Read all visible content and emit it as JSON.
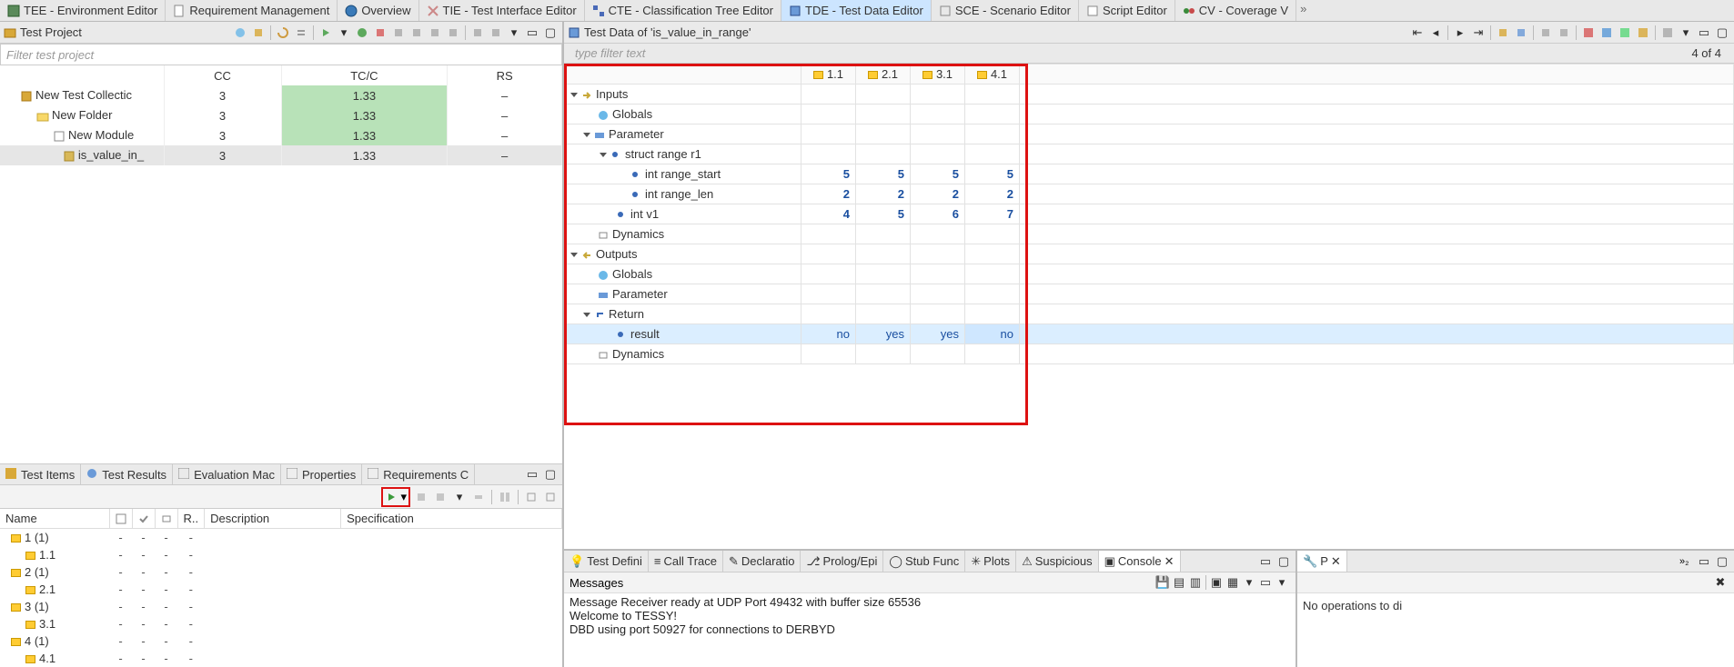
{
  "top_tabs": {
    "tee": "TEE - Environment Editor",
    "req": "Requirement Management",
    "ovw": "Overview",
    "tie": "TIE - Test Interface Editor",
    "cte": "CTE - Classification Tree Editor",
    "tde": "TDE - Test Data Editor",
    "sce": "SCE - Scenario Editor",
    "scr": "Script Editor",
    "cv": "CV - Coverage V"
  },
  "left": {
    "title": "Test Project",
    "filter_ph": "Filter test project",
    "cols": {
      "cc": "CC",
      "tcc": "TC/C",
      "rs": "RS"
    },
    "rows": [
      {
        "name": "New Test Collectic",
        "cc": "3",
        "tcc": "1.33",
        "rs": "–",
        "indent": 1,
        "green": true,
        "icon": "cube"
      },
      {
        "name": "New Folder",
        "cc": "3",
        "tcc": "1.33",
        "rs": "–",
        "indent": 2,
        "green": true,
        "icon": "folder"
      },
      {
        "name": "New Module",
        "cc": "3",
        "tcc": "1.33",
        "rs": "–",
        "indent": 3,
        "green": true,
        "icon": "module"
      },
      {
        "name": "is_value_in_",
        "cc": "3",
        "tcc": "1.33",
        "rs": "–",
        "indent": 4,
        "green": false,
        "icon": "func",
        "sel": true
      }
    ]
  },
  "mid_tabs": {
    "ti": "Test Items",
    "tr": "Test Results",
    "em": "Evaluation Mac",
    "pr": "Properties",
    "rc": "Requirements C"
  },
  "items": {
    "cols": {
      "name": "Name",
      "desc": "Description",
      "spec": "Specification",
      "r": "R.."
    },
    "rows": [
      {
        "name": "1 (1)",
        "lvl": 0
      },
      {
        "name": "1.1",
        "lvl": 1
      },
      {
        "name": "2 (1)",
        "lvl": 0
      },
      {
        "name": "2.1",
        "lvl": 1
      },
      {
        "name": "3 (1)",
        "lvl": 0
      },
      {
        "name": "3.1",
        "lvl": 1
      },
      {
        "name": "4 (1)",
        "lvl": 0
      },
      {
        "name": "4.1",
        "lvl": 1
      }
    ]
  },
  "right": {
    "title": "Test Data of 'is_value_in_range'",
    "filter_ph": "type filter text",
    "counter": "4 of 4",
    "col_heads": [
      "1.1",
      "2.1",
      "3.1",
      "4.1"
    ],
    "tree": {
      "inputs": "Inputs",
      "globals": "Globals",
      "parameter": "Parameter",
      "struct": "struct range r1",
      "range_start": "int range_start",
      "range_len": "int range_len",
      "v1": "int v1",
      "dynamics": "Dynamics",
      "outputs": "Outputs",
      "return": "Return",
      "result": "result"
    },
    "vals": {
      "range_start": [
        "5",
        "5",
        "5",
        "5"
      ],
      "range_len": [
        "2",
        "2",
        "2",
        "2"
      ],
      "v1": [
        "4",
        "5",
        "6",
        "7"
      ],
      "result": [
        "no",
        "yes",
        "yes",
        "no"
      ]
    }
  },
  "bottom": {
    "tabs": {
      "td": "Test Defini",
      "ct": "Call Trace",
      "dc": "Declaratio",
      "pe": "Prolog/Epi",
      "sf": "Stub Func",
      "pl": "Plots",
      "su": "Suspicious",
      "co": "Console"
    },
    "msg_hdr": "Messages",
    "lines": [
      "Message Receiver ready at UDP Port 49432 with buffer size 65536",
      "Welcome to TESSY!",
      "DBD using port 50927 for connections to DERBYD"
    ],
    "ptab": "P",
    "noop": "No operations to di"
  }
}
